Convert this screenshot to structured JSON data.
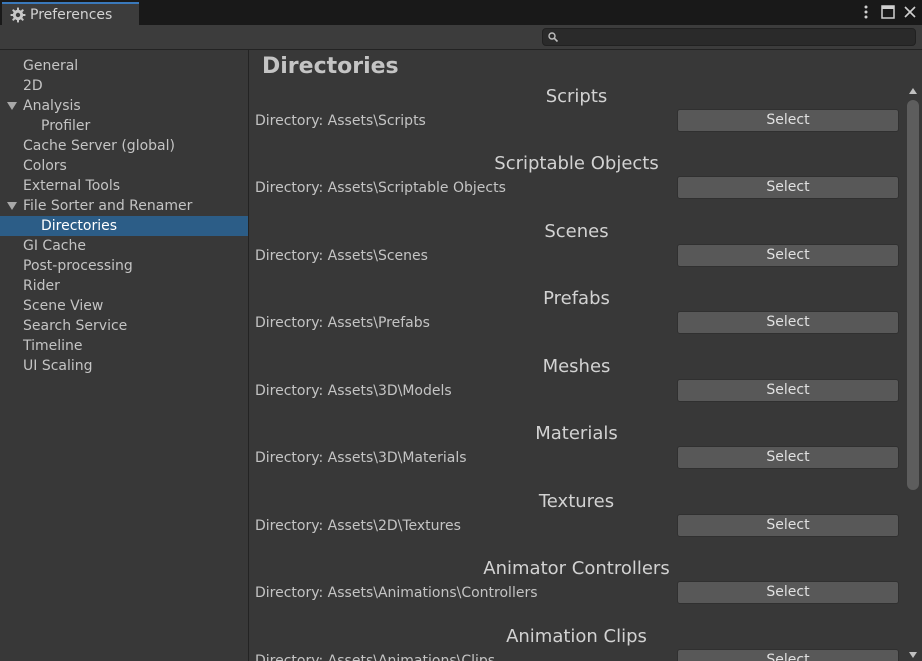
{
  "window": {
    "tab_title": "Preferences",
    "controls": [
      "menu-icon",
      "maximize-icon",
      "close-icon"
    ]
  },
  "search": {
    "placeholder": "",
    "value": ""
  },
  "sidebar": {
    "items": [
      {
        "label": "General",
        "indent": 0,
        "selected": false
      },
      {
        "label": "2D",
        "indent": 0,
        "selected": false
      },
      {
        "label": "Analysis",
        "indent": 0,
        "selected": false,
        "expanded": true
      },
      {
        "label": "Profiler",
        "indent": 1,
        "selected": false
      },
      {
        "label": "Cache Server (global)",
        "indent": 0,
        "selected": false
      },
      {
        "label": "Colors",
        "indent": 0,
        "selected": false
      },
      {
        "label": "External Tools",
        "indent": 0,
        "selected": false
      },
      {
        "label": "File Sorter and Renamer",
        "indent": 0,
        "selected": false,
        "expanded": true
      },
      {
        "label": "Directories",
        "indent": 1,
        "selected": true
      },
      {
        "label": "GI Cache",
        "indent": 0,
        "selected": false
      },
      {
        "label": "Post-processing",
        "indent": 0,
        "selected": false
      },
      {
        "label": "Rider",
        "indent": 0,
        "selected": false
      },
      {
        "label": "Scene View",
        "indent": 0,
        "selected": false
      },
      {
        "label": "Search Service",
        "indent": 0,
        "selected": false
      },
      {
        "label": "Timeline",
        "indent": 0,
        "selected": false
      },
      {
        "label": "UI Scaling",
        "indent": 0,
        "selected": false
      }
    ]
  },
  "main": {
    "title": "Directories",
    "sections": [
      {
        "heading": "Scripts",
        "directory": "Directory: Assets\\Scripts",
        "button": "Select"
      },
      {
        "heading": "Scriptable Objects",
        "directory": "Directory: Assets\\Scriptable Objects",
        "button": "Select"
      },
      {
        "heading": "Scenes",
        "directory": "Directory: Assets\\Scenes",
        "button": "Select"
      },
      {
        "heading": "Prefabs",
        "directory": "Directory: Assets\\Prefabs",
        "button": "Select"
      },
      {
        "heading": "Meshes",
        "directory": "Directory: Assets\\3D\\Models",
        "button": "Select"
      },
      {
        "heading": "Materials",
        "directory": "Directory: Assets\\3D\\Materials",
        "button": "Select"
      },
      {
        "heading": "Textures",
        "directory": "Directory: Assets\\2D\\Textures",
        "button": "Select"
      },
      {
        "heading": "Animator Controllers",
        "directory": "Directory: Assets\\Animations\\Controllers",
        "button": "Select"
      },
      {
        "heading": "Animation Clips",
        "directory": "Directory: Assets\\Animations\\Clips",
        "button": "Select"
      }
    ]
  },
  "colors": {
    "selection": "#2c5d87",
    "tab_accent": "#3a79bb",
    "button": "#585858",
    "panel": "#383838"
  }
}
